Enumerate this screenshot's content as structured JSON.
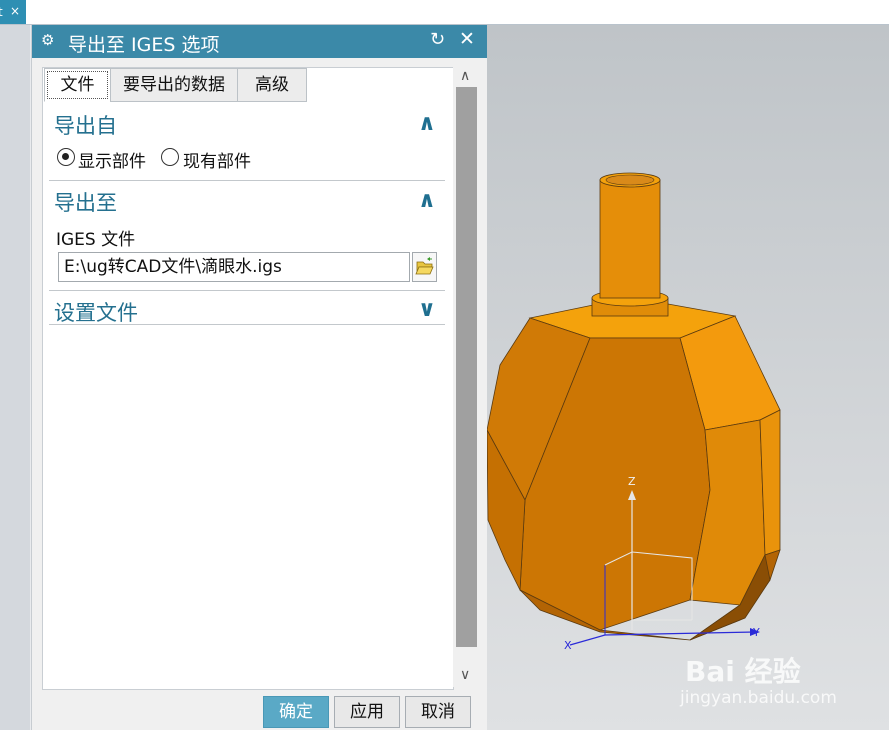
{
  "window": {
    "doc_tab": {
      "text": "t",
      "close": "×"
    }
  },
  "dialog": {
    "title": "导出至 IGES 选项",
    "icons": {
      "settings": "gear-icon",
      "reset": "reset-icon",
      "close": "close-icon"
    },
    "tabs": [
      {
        "label": "文件",
        "active": true
      },
      {
        "label": "要导出的数据",
        "active": false
      },
      {
        "label": "高级",
        "active": false
      }
    ],
    "sections": {
      "export_from": {
        "title": "导出自",
        "expanded": true,
        "options": [
          {
            "label": "显示部件",
            "selected": true
          },
          {
            "label": "现有部件",
            "selected": false
          }
        ]
      },
      "export_to": {
        "title": "导出至",
        "expanded": true,
        "field_label": "IGES 文件",
        "path_value": "E:\\ug转CAD文件\\滴眼水.igs"
      },
      "settings_file": {
        "title": "设置文件",
        "expanded": false
      }
    },
    "buttons": {
      "ok": "确定",
      "apply": "应用",
      "cancel": "取消"
    }
  },
  "viewport": {
    "triad": {
      "x": "X",
      "y": "Y",
      "z": "Z"
    },
    "model_color": "#d98a1a"
  },
  "watermark": {
    "logo": "Bai 经验",
    "sub": "jingyan.baidu.com"
  },
  "colors": {
    "titlebar": "#3b89a8",
    "accent_text": "#24708f",
    "primary_button": "#5aa9c6"
  }
}
